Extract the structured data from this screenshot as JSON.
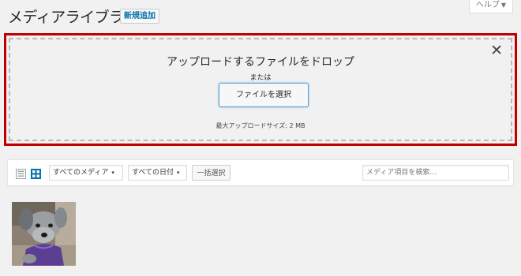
{
  "header": {
    "title": "メディアライブラリ",
    "add_new_label": "新規追加",
    "help_label": "ヘルプ",
    "help_caret": "▼"
  },
  "uploader": {
    "drop_title": "アップロードするファイルをドロップ",
    "or_text": "または",
    "select_button": "ファイルを選択",
    "max_size": "最大アップロードサイズ: 2 MB",
    "close_glyph": "✕"
  },
  "toolbar": {
    "media_type_selected": "すべてのメディア",
    "date_selected": "すべての日付",
    "dropdown_arrow": "▾",
    "bulk_select_label": "一括選択",
    "search_placeholder": "メディア項目を検索..."
  },
  "view_modes": {
    "list_icon": "list-view-icon",
    "grid_icon": "grid-view-icon",
    "active": "grid"
  },
  "media_items": [
    {
      "type": "image",
      "subject": "dog-photo"
    }
  ],
  "colors": {
    "highlight_border": "#c00000",
    "link_blue": "#0073aa",
    "grid_icon_active": "#0073aa",
    "list_icon_inactive": "#a0a5aa"
  }
}
